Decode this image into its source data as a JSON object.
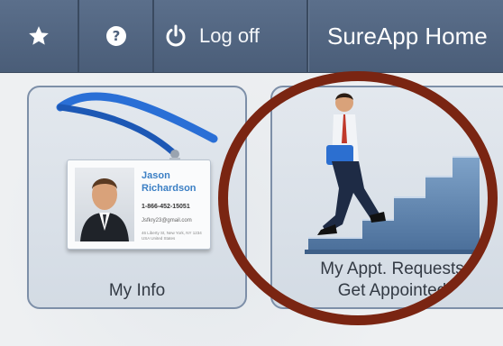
{
  "navbar": {
    "star_icon": "star-icon",
    "help_icon": "question-circle-icon",
    "power_icon": "power-icon",
    "logoff_label": "Log off",
    "title": "SureApp Home",
    "bg_color": "#4e617c"
  },
  "tiles": [
    {
      "label": "My Info",
      "icon": "id-badge-icon",
      "badge": {
        "first_name": "Jason",
        "last_name": "Richardson",
        "phone": "1-866-452-15051",
        "email": "Jsfkry23@gmail.com",
        "address": "46 Liberty St, New York, NY 1234 USA United States"
      }
    },
    {
      "label_line1": "My Appt. Requests",
      "label_line2": "Get Appointed",
      "icon": "businessman-climbing-stairs-icon"
    }
  ],
  "highlight_color": "#7a2512"
}
